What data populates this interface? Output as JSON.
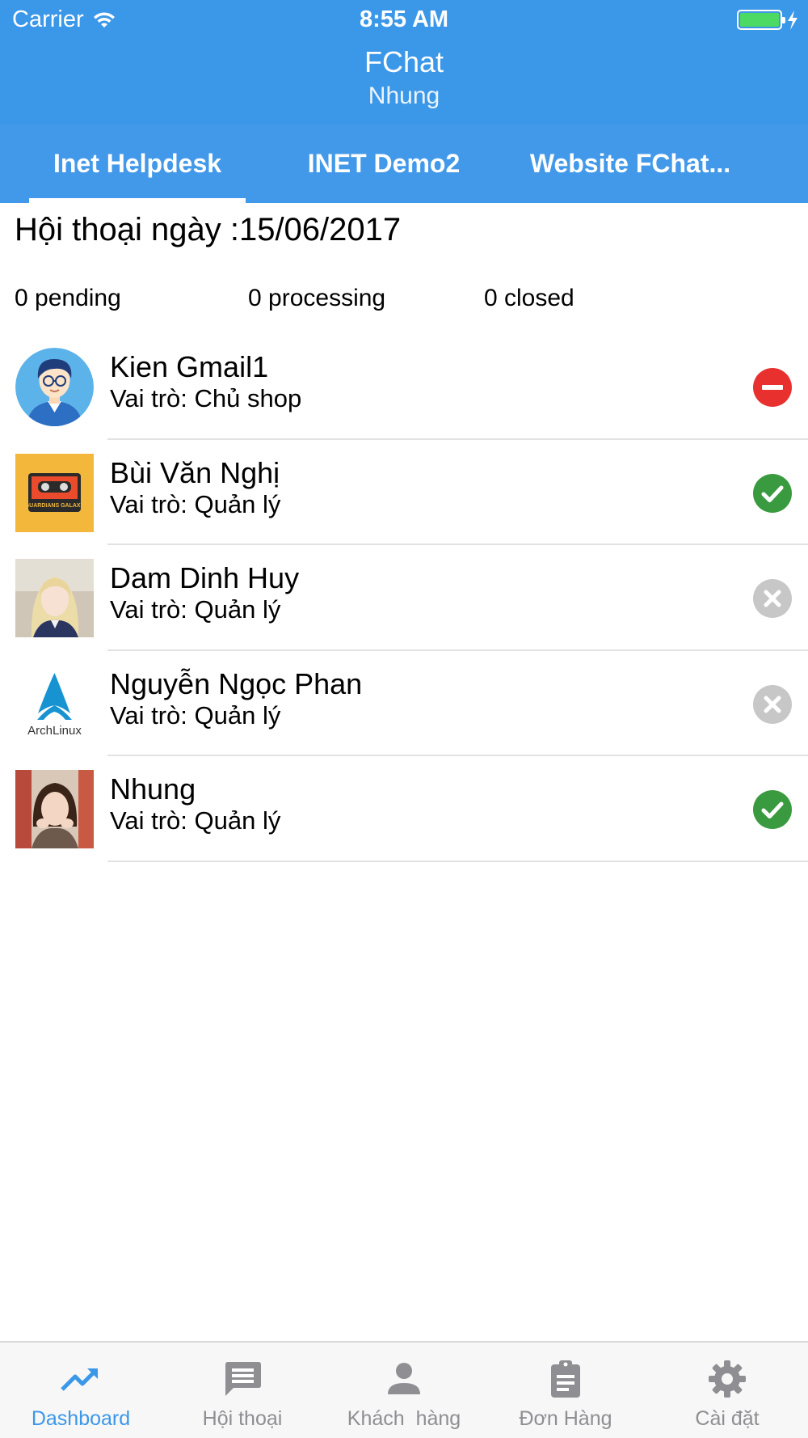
{
  "status_bar": {
    "carrier": "Carrier",
    "time": "8:55 AM"
  },
  "header": {
    "title": "FChat",
    "subtitle": "Nhung"
  },
  "tabs": [
    {
      "label": "Inet Helpdesk",
      "active": true
    },
    {
      "label": "INET Demo2",
      "active": false
    },
    {
      "label": "Website FChat...",
      "active": false
    }
  ],
  "date_line": "Hội thoại ngày :15/06/2017",
  "stats": {
    "pending": "0 pending",
    "processing": "0 processing",
    "closed": "0 closed"
  },
  "members": [
    {
      "name": "Kien Gmail1",
      "role": "Vai trò: Chủ shop",
      "status": "blocked-icon",
      "status_color": "#e8312f"
    },
    {
      "name": "Bùi Văn Nghị",
      "role": "Vai trò: Quản lý",
      "status": "check-circle-icon",
      "status_color": "#3a9a3f"
    },
    {
      "name": "Dam Dinh Huy",
      "role": "Vai trò: Quản lý",
      "status": "x-circle-icon",
      "status_color": "#c7c7c7"
    },
    {
      "name": "Nguyễn Ngọc Phan",
      "role": "Vai trò: Quản lý",
      "status": "x-circle-icon",
      "status_color": "#c7c7c7"
    },
    {
      "name": "Nhung",
      "role": "Vai trò: Quản lý",
      "status": "check-circle-icon",
      "status_color": "#3a9a3f"
    }
  ],
  "avatar_art": {
    "arch_text": "ArchLinux",
    "cassette_text": "GUARDIANS GALAXY"
  },
  "bottom_nav": [
    {
      "label": "Dashboard",
      "icon": "trending-up-icon",
      "active": true
    },
    {
      "label": "Hội thoại",
      "icon": "chat-icon",
      "active": false
    },
    {
      "label": "Khách  hàng",
      "icon": "person-icon",
      "active": false
    },
    {
      "label": "Đơn Hàng",
      "icon": "clipboard-icon",
      "active": false
    },
    {
      "label": "Cài đặt",
      "icon": "gear-icon",
      "active": false
    }
  ],
  "colors": {
    "primary": "#3b97e8",
    "tab_bar": "#4399e9",
    "inactive": "#8e8e93",
    "divider": "#e2e2e2"
  }
}
